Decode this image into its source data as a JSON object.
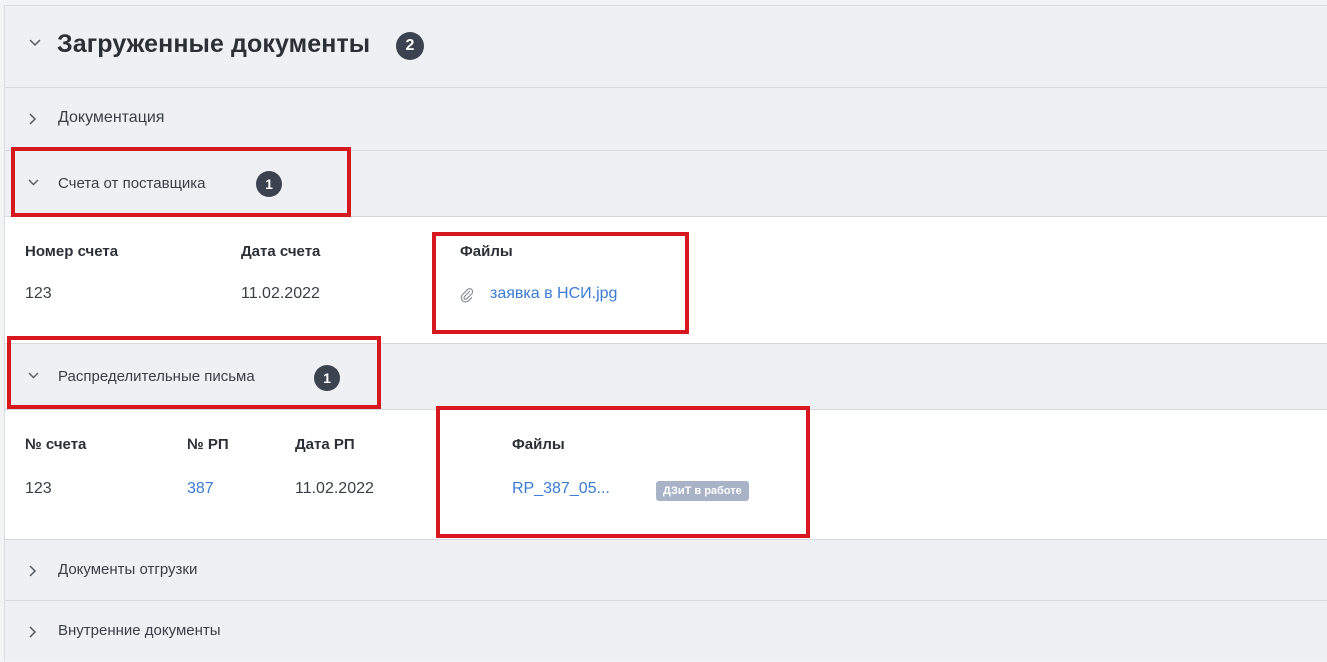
{
  "main": {
    "title": "Загруженные документы",
    "count": "2"
  },
  "sections": {
    "documentation": {
      "label": "Документация"
    },
    "invoices": {
      "label": "Счета от поставщика",
      "count": "1",
      "columns": [
        "Номер счета",
        "Дата счета",
        "Файлы"
      ],
      "row": {
        "number": "123",
        "date": "11.02.2022",
        "file": "заявка в НСИ.jpg"
      }
    },
    "letters": {
      "label": "Распределительные письма",
      "count": "1",
      "columns": [
        "№ счета",
        "№ РП",
        "Дата РП",
        "Файлы"
      ],
      "row": {
        "invoice": "123",
        "rp": "387",
        "date": "11.02.2022",
        "file": "RP_387_05...",
        "status": "ДЗиТ в работе"
      }
    },
    "shipping": {
      "label": "Документы отгрузки"
    },
    "internal": {
      "label": "Внутренние документы"
    }
  },
  "icons": {
    "collapse": "chevron-down-icon",
    "expand": "chevron-right-icon",
    "attachment": "paperclip-icon"
  },
  "colors": {
    "highlight": "#d7191f",
    "link": "#3a7bd5",
    "badge": "#3b4250",
    "status": "#a9b3c7"
  }
}
